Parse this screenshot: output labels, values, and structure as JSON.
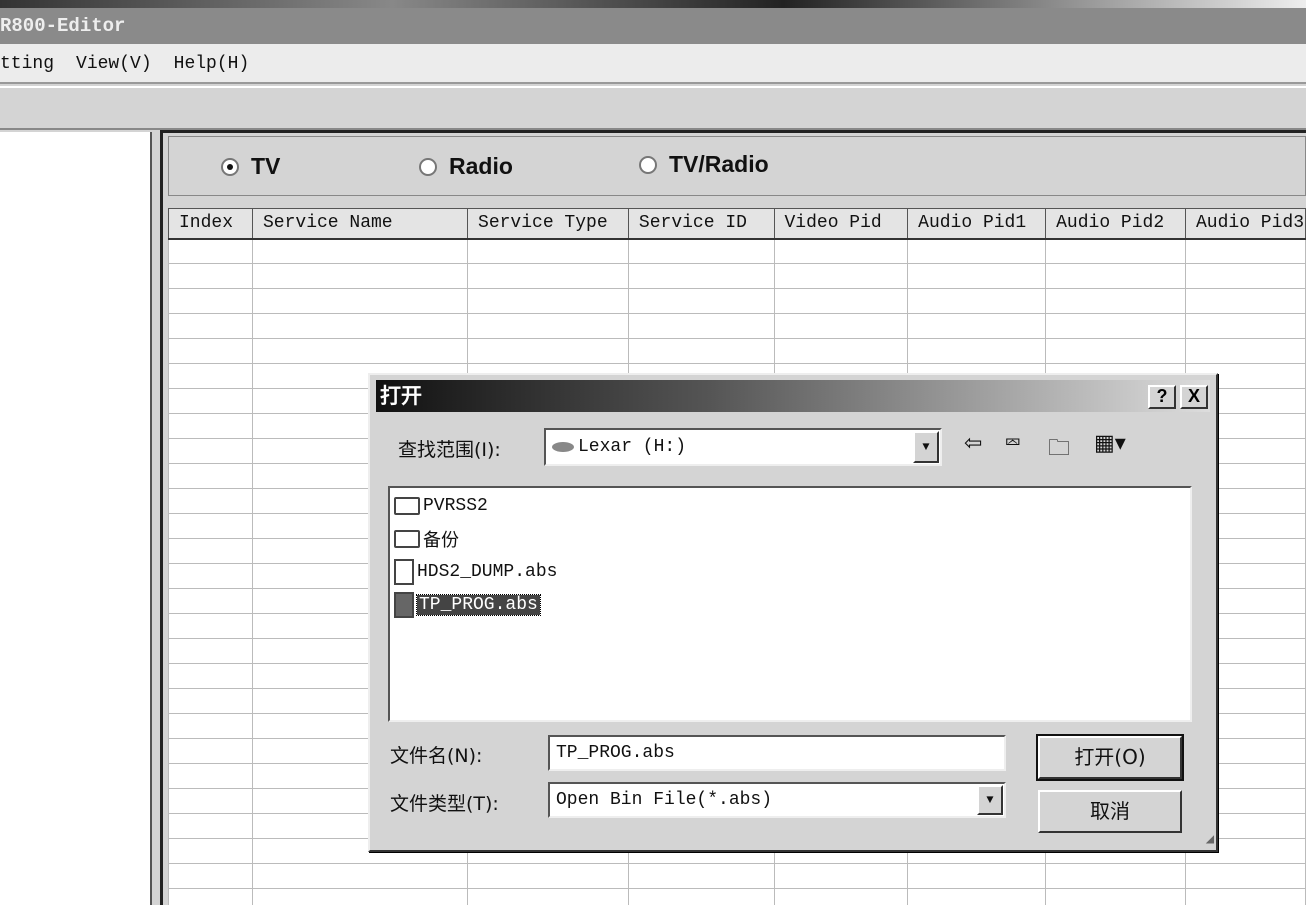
{
  "app": {
    "title": "R800-Editor"
  },
  "menu": [
    "tting",
    "View(V)",
    "Help(H)"
  ],
  "radios": [
    {
      "label": "TV",
      "checked": true
    },
    {
      "label": "Radio",
      "checked": false
    },
    {
      "label": "TV/Radio",
      "checked": false
    }
  ],
  "table": {
    "columns": [
      "Index",
      "Service Name",
      "Service Type",
      "Service ID",
      "Video Pid",
      "Audio Pid1",
      "Audio Pid2",
      "Audio Pid3"
    ]
  },
  "dialog": {
    "title": "打开",
    "help": "?",
    "close": "X",
    "look_in_label": "查找范围(I):",
    "look_in_value": "Lexar (H:)",
    "files": [
      {
        "name": "PVRSS2",
        "type": "folder"
      },
      {
        "name": "备份",
        "type": "folder"
      },
      {
        "name": "HDS2_DUMP.abs",
        "type": "file"
      },
      {
        "name": "TP_PROG.abs",
        "type": "file",
        "selected": true
      }
    ],
    "filename_label": "文件名(N):",
    "filename_value": "TP_PROG.abs",
    "filetype_label": "文件类型(T):",
    "filetype_value": "Open Bin File(*.abs)",
    "open_button": "打开(O)",
    "cancel_button": "取消"
  }
}
